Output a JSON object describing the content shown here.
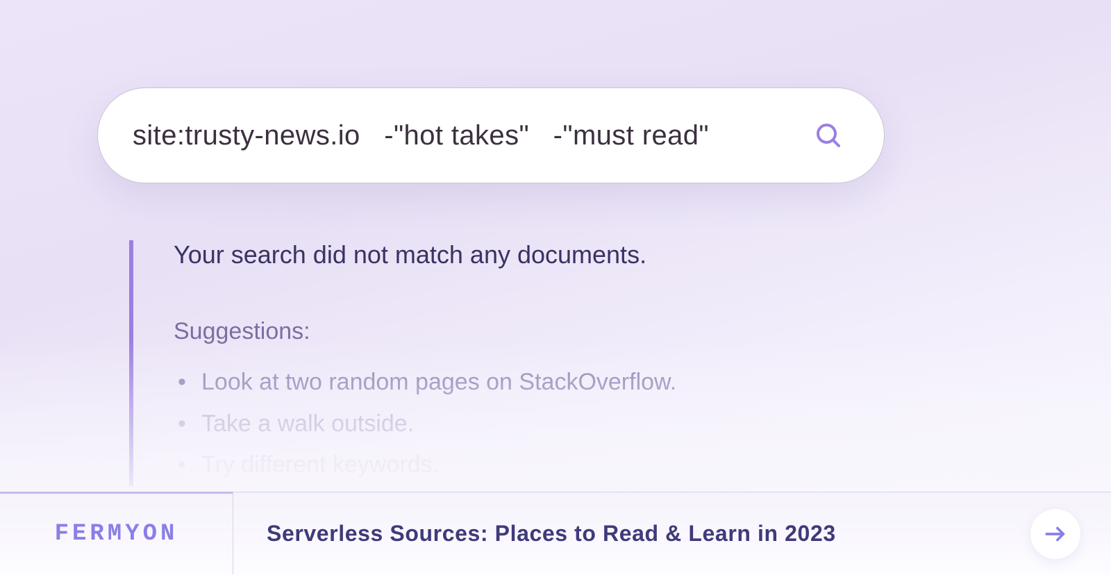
{
  "search": {
    "query": "site:trusty-news.io   -\"hot takes\"   -\"must read\""
  },
  "results": {
    "no_match": "Your search did not match any documents.",
    "suggestions_label": "Suggestions:",
    "suggestions": [
      "Look at two random pages on StackOverflow.",
      "Take a walk outside.",
      "Try different keywords."
    ]
  },
  "footer": {
    "brand": "FERMYON",
    "title": "Serverless Sources: Places to Read & Learn in 2023"
  },
  "colors": {
    "accent": "#9b7fe0",
    "text_primary": "#3a3262",
    "brand": "#8a7fe6"
  }
}
